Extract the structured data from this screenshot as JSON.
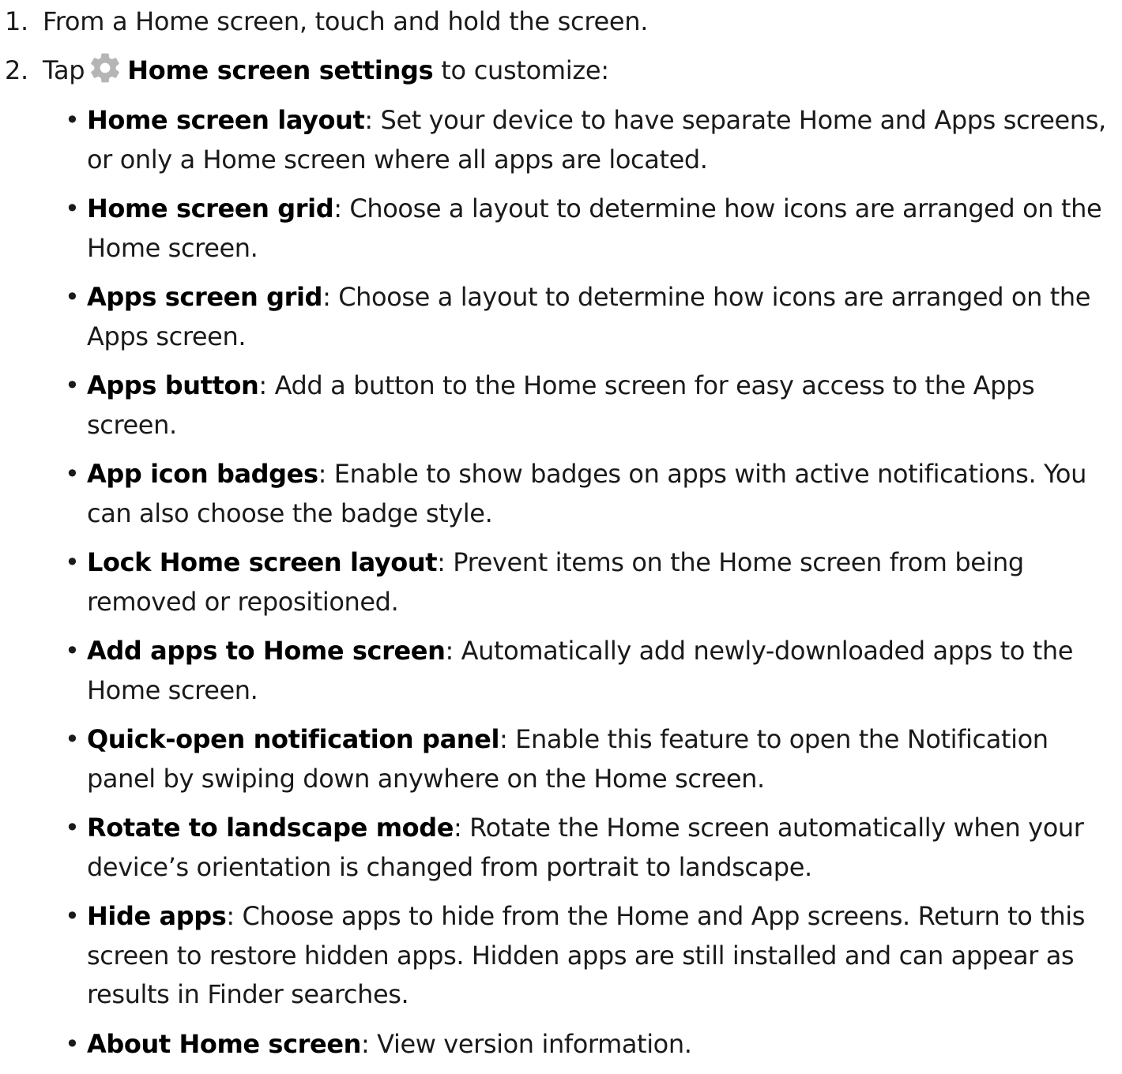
{
  "steps": [
    {
      "number": "1.",
      "text": "From a Home screen, touch and hold the screen."
    },
    {
      "number": "2.",
      "prefix": "Tap",
      "icon": "gear-icon",
      "icon_color": "#b5b5b5",
      "bold": "Home screen settings",
      "suffix": " to customize:"
    }
  ],
  "options": [
    {
      "term": "Home screen layout",
      "desc": ": Set your device to have separate Home and Apps screens, or only a Home screen where all apps are located."
    },
    {
      "term": "Home screen grid",
      "desc": ": Choose a layout to determine how icons are arranged on the Home screen."
    },
    {
      "term": "Apps screen grid",
      "desc": ": Choose a layout to determine how icons are arranged on the Apps screen."
    },
    {
      "term": "Apps button",
      "desc": ": Add a button to the Home screen for easy access to the Apps screen."
    },
    {
      "term": "App icon badges",
      "desc": ": Enable to show badges on apps with active notifications. You can also choose the badge style."
    },
    {
      "term": "Lock Home screen layout",
      "desc": ": Prevent items on the Home screen from being removed or repositioned."
    },
    {
      "term": "Add apps to Home screen",
      "desc": ": Automatically add newly-downloaded apps to the Home screen."
    },
    {
      "term": "Quick-open notification panel",
      "desc": ": Enable this feature to open the Notification panel by swiping down anywhere on the Home screen."
    },
    {
      "term": "Rotate to landscape mode",
      "desc": ": Rotate the Home screen automatically when your device’s orientation is changed from portrait to landscape."
    },
    {
      "term": "Hide apps",
      "desc": ": Choose apps to hide from the Home and App screens. Return to this screen to restore hidden apps. Hidden apps are still installed and can appear as results in Finder searches."
    },
    {
      "term": "About Home screen",
      "desc": ": View version information."
    }
  ]
}
